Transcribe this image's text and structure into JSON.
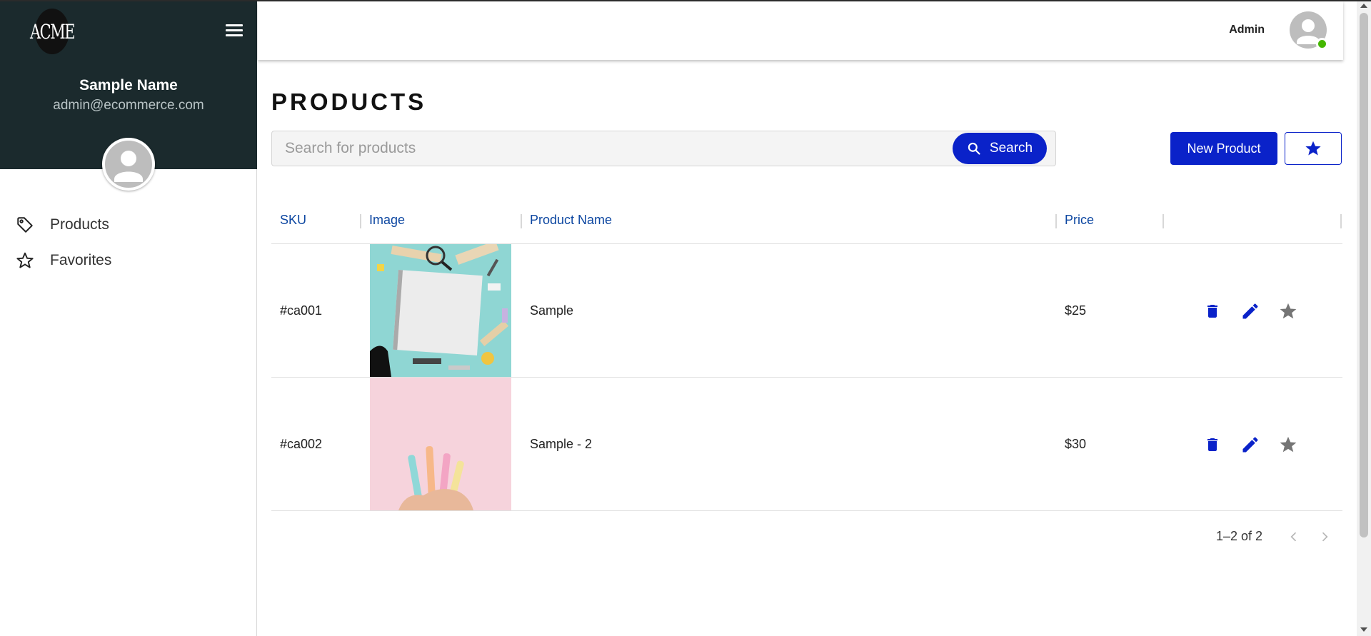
{
  "brand": {
    "logo_text": "ACME"
  },
  "user": {
    "name": "Sample Name",
    "email": "admin@ecommerce.com"
  },
  "sidebar": {
    "items": [
      {
        "label": "Products",
        "icon": "tag-icon"
      },
      {
        "label": "Favorites",
        "icon": "star-outline-icon"
      }
    ]
  },
  "topbar": {
    "role_label": "Admin",
    "status": "online"
  },
  "page": {
    "title": "PRODUCTS"
  },
  "search": {
    "placeholder": "Search for products",
    "value": "",
    "button_label": "Search"
  },
  "toolbar": {
    "new_button_label": "New Product",
    "favorites_icon": "star-icon"
  },
  "table": {
    "columns": [
      "SKU",
      "Image",
      "Product Name",
      "Price"
    ],
    "rows": [
      {
        "sku": "#ca001",
        "image": "notebook-stationery-photo",
        "name": "Sample",
        "price": "$25"
      },
      {
        "sku": "#ca002",
        "image": "pastel-pens-photo",
        "name": "Sample - 2",
        "price": "$30"
      }
    ]
  },
  "pagination": {
    "range_text": "1–2 of 2"
  },
  "colors": {
    "primary": "#0a22c9",
    "sidebar_header": "#1b2a2d",
    "header_text": "#0d47a1",
    "online": "#44b700"
  }
}
